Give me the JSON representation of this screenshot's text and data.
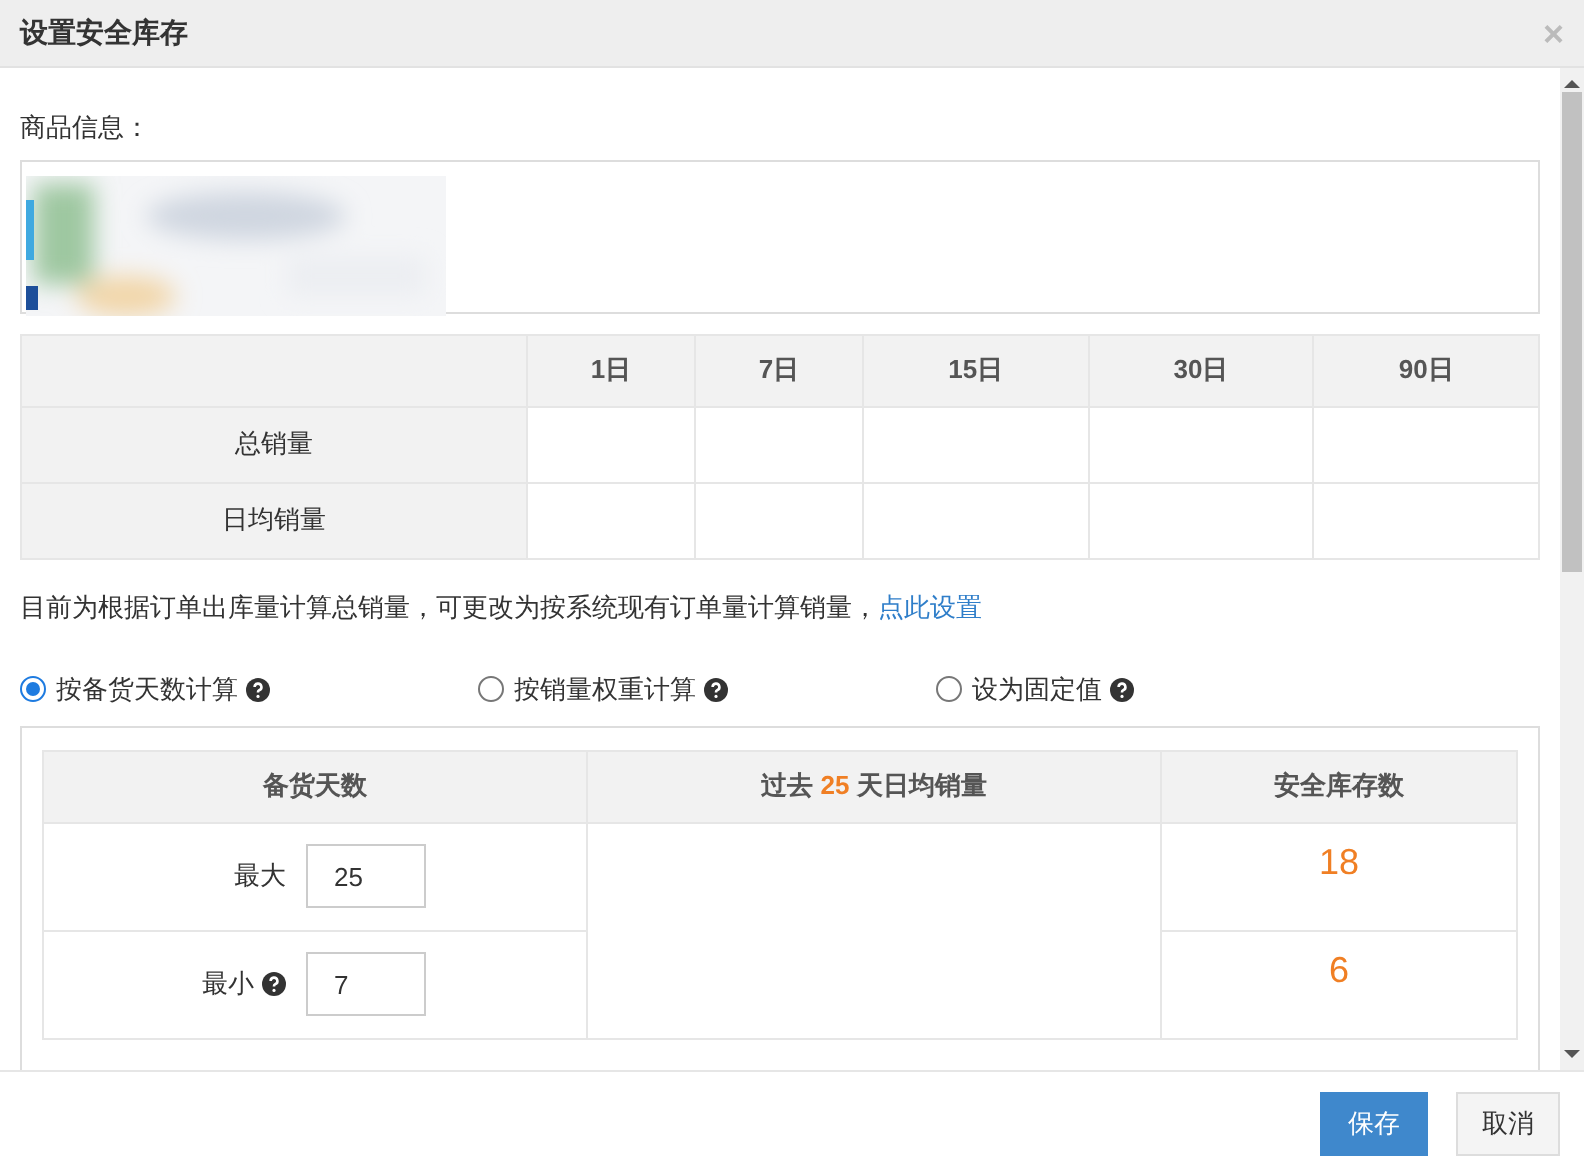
{
  "dialog": {
    "title": "设置安全库存",
    "close": "×"
  },
  "product": {
    "label": "商品信息："
  },
  "sales_table": {
    "columns": [
      "1日",
      "7日",
      "15日",
      "30日",
      "90日"
    ],
    "rows": [
      {
        "label": "总销量"
      },
      {
        "label": "日均销量"
      }
    ]
  },
  "note": {
    "text": "目前为根据订单出库量计算总销量，可更改为按系统现有订单量计算销量，",
    "link": "点此设置"
  },
  "methods": [
    {
      "label": "按备货天数计算",
      "selected": true
    },
    {
      "label": "按销量权重计算",
      "selected": false
    },
    {
      "label": "设为固定值",
      "selected": false
    }
  ],
  "calc_table": {
    "columns": [
      {
        "text": "备货天数"
      },
      {
        "prefix": "过去",
        "days": "25",
        "suffix": "天日均销量"
      },
      {
        "text": "安全库存数"
      }
    ],
    "rows": [
      {
        "label": "最大",
        "help": false,
        "value": "25",
        "result": "18"
      },
      {
        "label": "最小",
        "help": true,
        "value": "7",
        "result": "6"
      }
    ]
  },
  "buttons": [
    {
      "label": "保存",
      "kind": "primary"
    },
    {
      "label": "取消",
      "kind": "default"
    }
  ]
}
